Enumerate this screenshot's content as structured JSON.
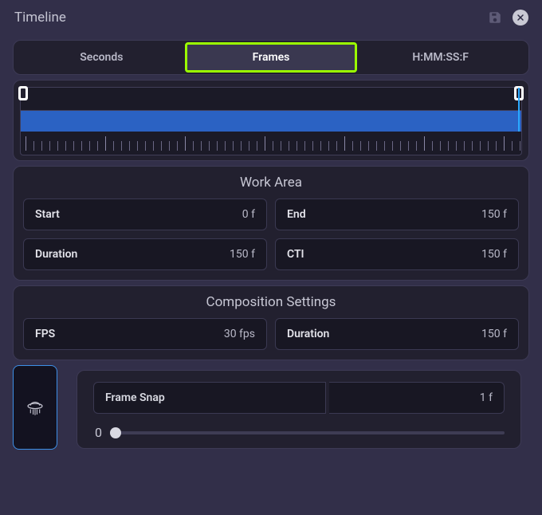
{
  "header": {
    "title": "Timeline"
  },
  "tabs": [
    {
      "label": "Seconds"
    },
    {
      "label": "Frames"
    },
    {
      "label": "H:MM:SS:F"
    }
  ],
  "workArea": {
    "title": "Work Area",
    "start": {
      "label": "Start",
      "value": "0 f"
    },
    "end": {
      "label": "End",
      "value": "150 f"
    },
    "duration": {
      "label": "Duration",
      "value": "150 f"
    },
    "cti": {
      "label": "CTI",
      "value": "150 f"
    }
  },
  "compSettings": {
    "title": "Composition Settings",
    "fps": {
      "label": "FPS",
      "value": "30 fps"
    },
    "duration": {
      "label": "Duration",
      "value": "150 f"
    }
  },
  "frameSnap": {
    "label": "Frame Snap",
    "value": "1 f",
    "sliderMin": "0"
  },
  "icons": {
    "save": "save-icon",
    "close": "close-icon",
    "mode": "ufo-icon"
  }
}
